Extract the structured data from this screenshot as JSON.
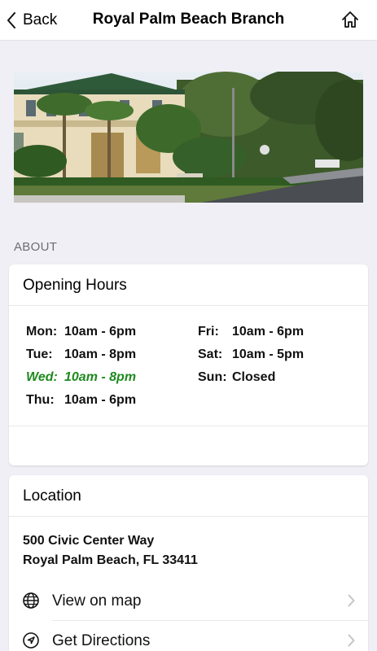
{
  "nav": {
    "back_label": "Back",
    "title": "Royal Palm Beach Branch",
    "home_icon": "home-icon"
  },
  "hero": {
    "alt": "Royal Palm Beach Branch library building photo"
  },
  "about": {
    "section_label": "ABOUT",
    "hours_title": "Opening Hours",
    "hours": [
      {
        "day": "Mon:",
        "time": "10am - 6pm"
      },
      {
        "day": "Tue:",
        "time": "10am - 8pm"
      },
      {
        "day": "Wed:",
        "time": "10am - 8pm",
        "today": true
      },
      {
        "day": "Thu:",
        "time": "10am - 6pm"
      },
      {
        "day": "Fri:",
        "time": "10am - 6pm"
      },
      {
        "day": "Sat:",
        "time": "10am - 5pm"
      },
      {
        "day": "Sun:",
        "time": "Closed"
      }
    ],
    "today_color": "#1e8a1e"
  },
  "location": {
    "title": "Location",
    "address_line1": "500 Civic Center Way",
    "address_line2": "Royal Palm Beach, FL 33411",
    "links": [
      {
        "label": "View on map",
        "icon": "globe-icon"
      },
      {
        "label": "Get Directions",
        "icon": "navigation-arrow-icon"
      }
    ]
  }
}
